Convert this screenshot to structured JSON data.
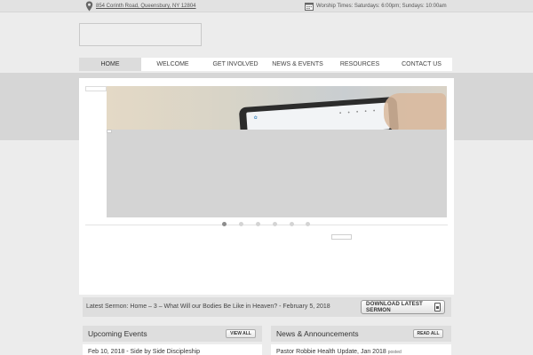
{
  "topbar": {
    "address": "854 Corinth Road, Queensbury, NY 12804",
    "worship_times": "Worship Times: Saturdays: 6:00pm; Sundays: 10:00am",
    "address_icon": "map-pin-icon",
    "worship_icon": "calendar-icon"
  },
  "nav": {
    "items": [
      {
        "label": "HOME",
        "active": true
      },
      {
        "label": "WELCOME",
        "active": false
      },
      {
        "label": "GET INVOLVED",
        "active": false
      },
      {
        "label": "NEWS & EVENTS",
        "active": false
      },
      {
        "label": "RESOURCES",
        "active": false
      },
      {
        "label": "CONTACT US",
        "active": false
      }
    ]
  },
  "slider": {
    "slide_count": 6,
    "active_slide": 1
  },
  "sermon": {
    "text": "Latest Sermon: Home – 3 – What Will our Bodies Be Like in Heaven? - February 5, 2018",
    "button_label": "DOWNLOAD LATEST SERMON"
  },
  "events": {
    "title": "Upcoming Events",
    "button_label": "VIEW ALL",
    "first_item": "Feb 10, 2018 - Side by Side Discipleship"
  },
  "news": {
    "title": "News & Announcements",
    "button_label": "READ ALL",
    "first_item": "Pastor Robbie Health Update, Jan 2018",
    "first_item_suffix": "posted"
  },
  "colors": {
    "page_bg": "#ececec",
    "band": "#d6d6d6",
    "nav_active": "#dcdcdc",
    "dot_active": "#8c8c8c"
  }
}
